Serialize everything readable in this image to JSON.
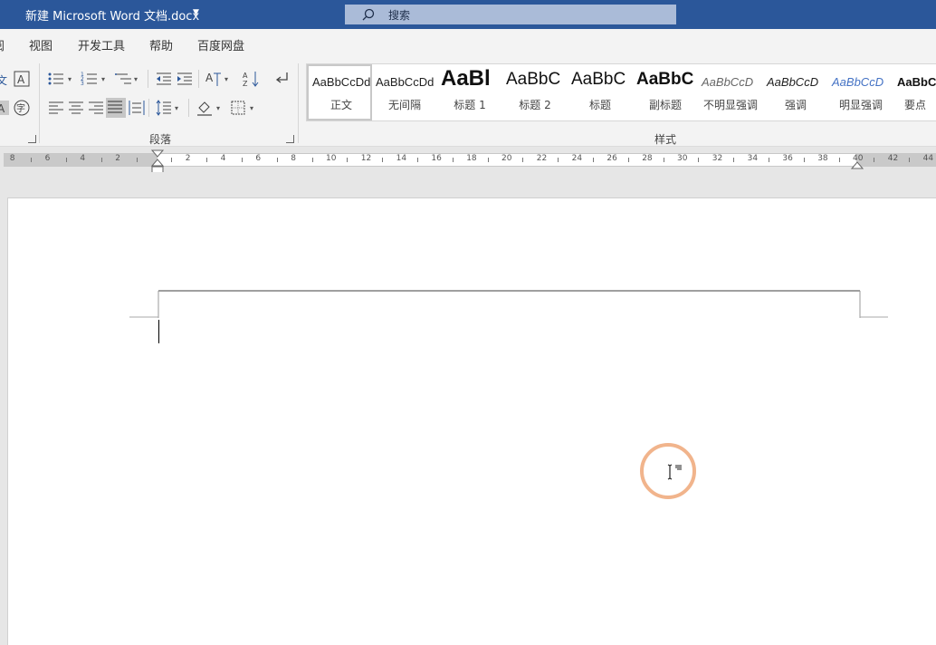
{
  "window": {
    "title": "新建 Microsoft Word 文档.docx",
    "search_placeholder": "搜索"
  },
  "menu": {
    "tabs": [
      "阅",
      "视图",
      "开发工具",
      "帮助",
      "百度网盘"
    ]
  },
  "ribbon": {
    "paragraph_group_label": "段落",
    "styles_group_label": "样式",
    "styles": [
      {
        "sample": "AaBbCcDd",
        "name": "正文",
        "selected": true
      },
      {
        "sample": "AaBbCcDd",
        "name": "无间隔",
        "selected": false
      },
      {
        "sample": "AaBl",
        "name": "标题 1",
        "selected": false
      },
      {
        "sample": "AaBbC",
        "name": "标题 2",
        "selected": false
      },
      {
        "sample": "AaBbC",
        "name": "标题",
        "selected": false
      },
      {
        "sample": "AaBbC",
        "name": "副标题",
        "selected": false
      },
      {
        "sample": "AaBbCcD",
        "name": "不明显强调",
        "selected": false
      },
      {
        "sample": "AaBbCcD",
        "name": "强调",
        "selected": false
      },
      {
        "sample": "AaBbCcD",
        "name": "明显强调",
        "selected": false
      },
      {
        "sample": "AaBbCc",
        "name": "要点",
        "selected": false
      }
    ]
  },
  "ruler": {
    "left_numbers": [
      "8",
      "6",
      "4",
      "2"
    ],
    "right_numbers": [
      "2",
      "4",
      "6",
      "8",
      "10",
      "12",
      "14",
      "16",
      "18",
      "20",
      "22",
      "24",
      "26",
      "28",
      "30",
      "32",
      "34",
      "36",
      "38",
      "40",
      "42",
      "44"
    ]
  },
  "colors": {
    "titlebar": "#2b579a",
    "highlight_ring": "#f1b48c"
  }
}
